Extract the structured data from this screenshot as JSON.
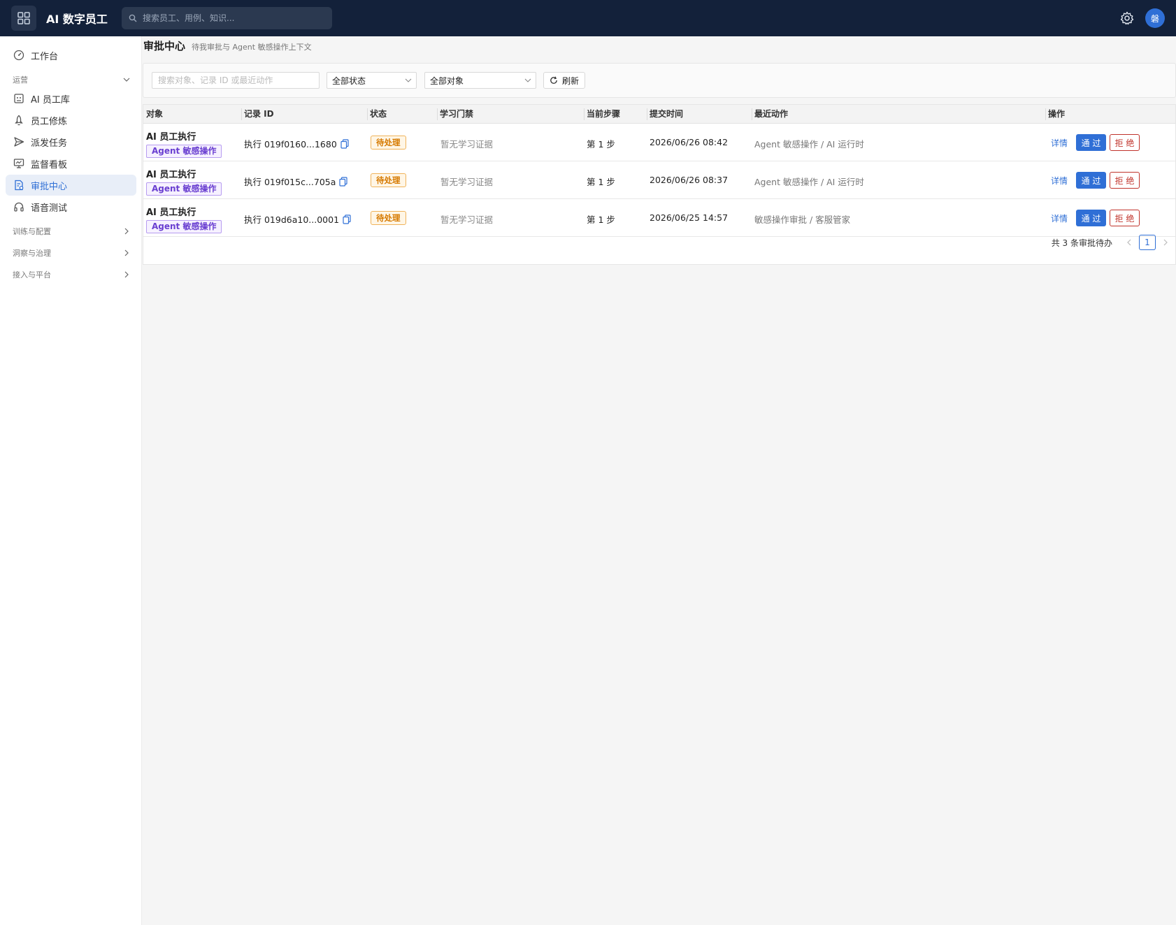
{
  "header": {
    "app_title": "AI 数字员工",
    "search_placeholder": "搜索员工、用例、知识...",
    "avatar_text": "磐"
  },
  "sidebar": {
    "top_item": {
      "label": "工作台",
      "icon": "dashboard-icon"
    },
    "groups": [
      {
        "label": "运营",
        "expanded": true
      },
      {
        "label": "训练与配置",
        "expanded": false
      },
      {
        "label": "洞察与治理",
        "expanded": false
      },
      {
        "label": "接入与平台",
        "expanded": false
      }
    ],
    "items": [
      {
        "label": "AI 员工库",
        "icon": "robot-icon",
        "active": false
      },
      {
        "label": "员工修炼",
        "icon": "rocket-icon",
        "active": false
      },
      {
        "label": "派发任务",
        "icon": "send-icon",
        "active": false
      },
      {
        "label": "监督看板",
        "icon": "monitor-icon",
        "active": false
      },
      {
        "label": "审批中心",
        "icon": "approval-icon",
        "active": true
      },
      {
        "label": "语音测试",
        "icon": "headset-icon",
        "active": false
      }
    ]
  },
  "page": {
    "title": "审批中心",
    "subtitle": "待我审批与 Agent 敏感操作上下文"
  },
  "filters": {
    "search_placeholder": "搜索对象、记录 ID 或最近动作",
    "status_value": "全部状态",
    "object_value": "全部对象",
    "refresh_label": "刷新"
  },
  "table": {
    "headers": [
      "对象",
      "记录 ID",
      "状态",
      "学习门禁",
      "当前步骤",
      "提交时间",
      "最近动作",
      "操作"
    ],
    "rows": [
      {
        "object": "AI 员工执行",
        "tag": "Agent 敏感操作",
        "record_id": "执行 019f0160...1680",
        "status": "待处理",
        "gate": "暂无学习证据",
        "step": "第 1 步",
        "time": "2026/06/26 08:42",
        "action": "Agent 敏感操作 / AI 运行时"
      },
      {
        "object": "AI 员工执行",
        "tag": "Agent 敏感操作",
        "record_id": "执行 019f015c...705a",
        "status": "待处理",
        "gate": "暂无学习证据",
        "step": "第 1 步",
        "time": "2026/06/26 08:37",
        "action": "Agent 敏感操作 / AI 运行时"
      },
      {
        "object": "AI 员工执行",
        "tag": "Agent 敏感操作",
        "record_id": "执行 019d6a10...0001",
        "status": "待处理",
        "gate": "暂无学习证据",
        "step": "第 1 步",
        "time": "2026/06/25 14:57",
        "action": "敏感操作审批 / 客服管家"
      }
    ],
    "op_detail": "详情",
    "op_pass": "通 过",
    "op_reject": "拒 绝"
  },
  "pagination": {
    "total_text": "共 3 条审批待办",
    "current_page": "1"
  },
  "colors": {
    "topbar": "#13213a",
    "accent": "#2f6fd6",
    "reject": "#c0332b",
    "pending": "#d67a00",
    "tag_purple": "#6a3fd1"
  }
}
